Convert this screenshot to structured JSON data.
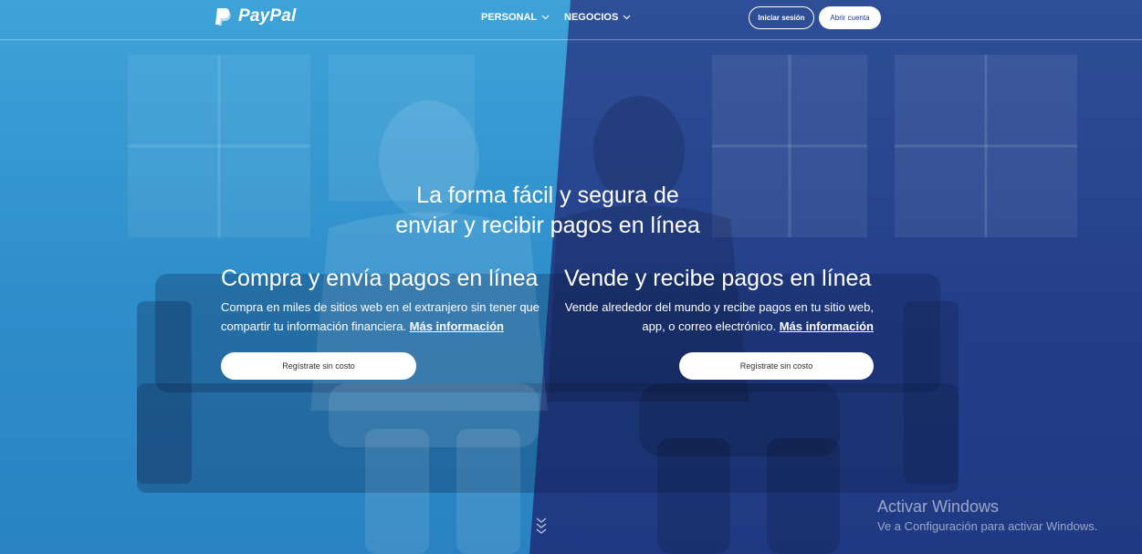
{
  "header": {
    "brand": "PayPal",
    "nav": [
      {
        "label": "PERSONAL"
      },
      {
        "label": "NEGOCIOS"
      }
    ],
    "login_label": "Iniciar sesión",
    "signup_label": "Abrir cuenta"
  },
  "hero": {
    "headline_line1": "La forma fácil y segura de",
    "headline_line2": "enviar y recibir pagos en línea",
    "left": {
      "title": "Compra y envía pagos en línea",
      "text": "Compra en miles de sitios web en el extranjero sin tener que compartir tu información financiera.",
      "link": "Más información",
      "cta": "Regístrate sin costo"
    },
    "right": {
      "title": "Vende y recibe pagos en línea",
      "text": "Vende alrededor del mundo y recibe pagos en tu sitio web, app, o correo electrónico.",
      "link": "Más información",
      "cta": "Regístrate sin costo"
    }
  },
  "os_watermark": {
    "title": "Activar Windows",
    "subtitle": "Ve a Configuración para activar Windows."
  },
  "colors": {
    "left_overlay": "#3ea3d8",
    "right_overlay": "#243f8a",
    "button_text": "#2c2e2f"
  },
  "icons": {
    "logo": "paypal-logo-icon",
    "nav_chevron": "chevron-down-icon",
    "scroll": "double-chevron-down-icon"
  }
}
